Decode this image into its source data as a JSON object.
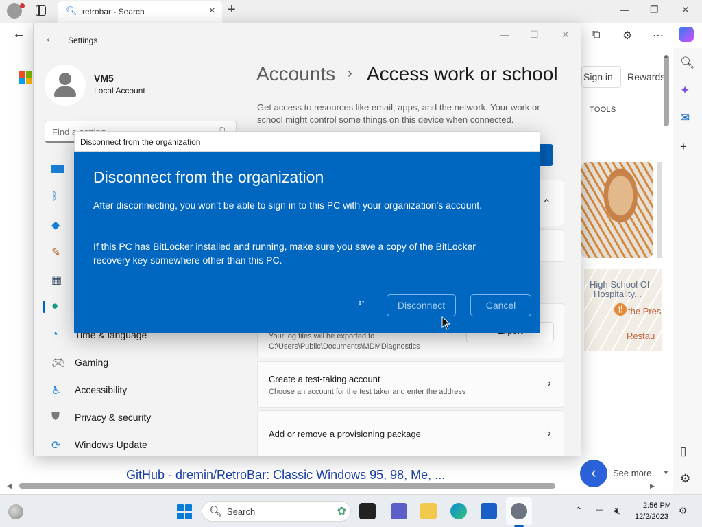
{
  "browser": {
    "tab_title": "retrobar - Search",
    "new_tab": "+",
    "sign_in": "Sign in",
    "rewards": "Rewards",
    "tools": "TOOLS",
    "map_labels": [
      "High School Of",
      "Hospitality..."
    ],
    "map_place": "the Pres",
    "map_place2": "Restau",
    "result_link": "GitHub - dremin/RetroBar: Classic Windows 95, 98, Me, ...",
    "see_more": "See more"
  },
  "settings": {
    "window_title": "Settings",
    "account_name": "VM5",
    "account_type": "Local Account",
    "search_placeholder": "Find a setting",
    "nav_items": [
      {
        "label": "Time & language"
      },
      {
        "label": "Gaming"
      },
      {
        "label": "Accessibility"
      },
      {
        "label": "Privacy & security"
      },
      {
        "label": "Windows Update"
      }
    ],
    "breadcrumb_parent": "Accounts",
    "breadcrumb_separator": "›",
    "breadcrumb_current": "Access work or school",
    "description": "Get access to resources like email, apps, and the network. Your work or school might control some things on this device when connected.",
    "diag_card": {
      "sub": "Your log files will be exported to C:\\Users\\Public\\Documents\\MDMDiagnostics",
      "button": "Export"
    },
    "cards": [
      {
        "title": "Create a test-taking account",
        "sub": "Choose an account for the test taker and enter the address"
      },
      {
        "title": "Add or remove a provisioning package",
        "sub": ""
      }
    ]
  },
  "dialog": {
    "caption": "Disconnect from the organization",
    "heading": "Disconnect from the organization",
    "paragraph1": "After disconnecting, you won’t be able to sign in to this PC with your organization’s account.",
    "paragraph2": "If this PC has BitLocker installed and running, make sure you save a copy of the BitLocker recovery key somewhere other than this PC.",
    "disconnect": "Disconnect",
    "cancel": "Cancel"
  },
  "taskbar": {
    "search": "Search",
    "time": "2:56 PM",
    "date": "12/2/2023"
  },
  "colors": {
    "dialog_bg": "#0067c0",
    "accent": "#005fb8"
  }
}
